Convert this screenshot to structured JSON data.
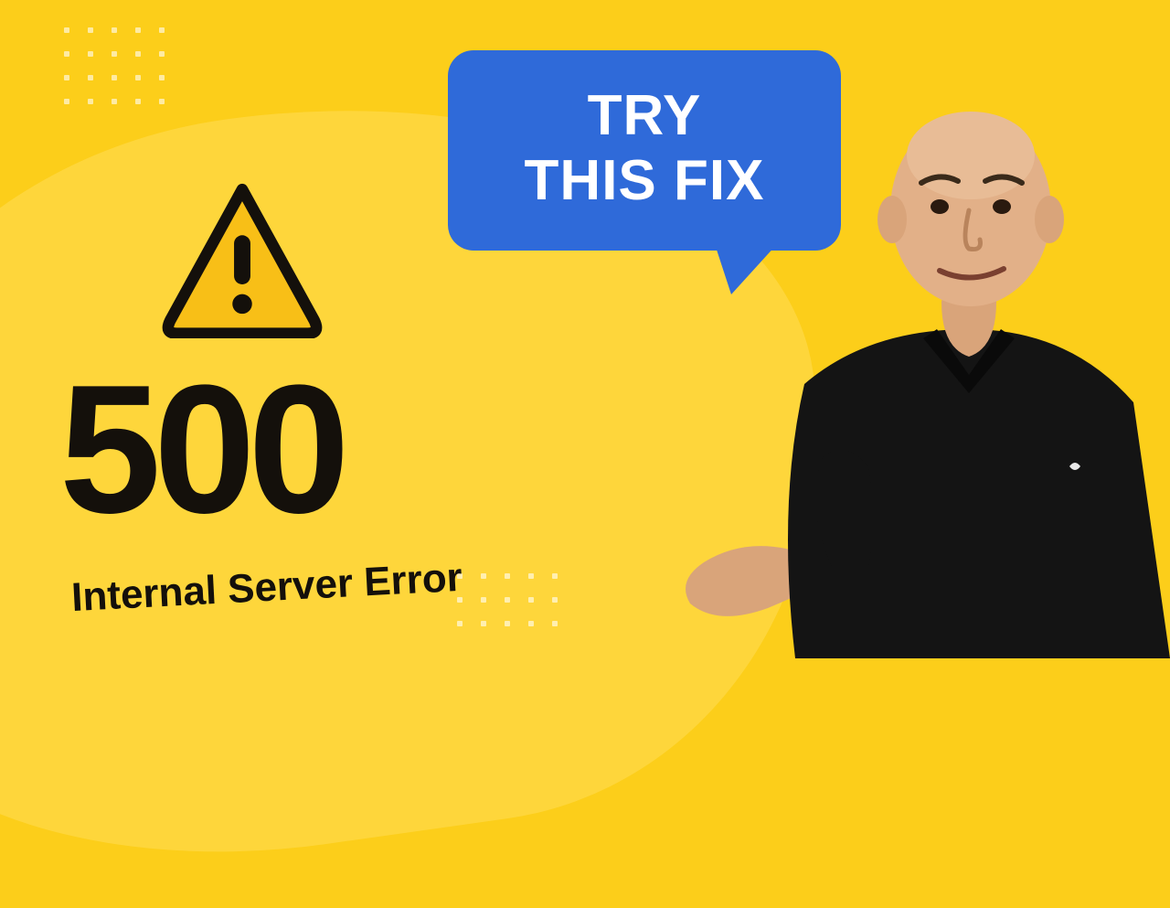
{
  "error": {
    "code": "500",
    "message": "Internal Server Error"
  },
  "bubble": {
    "line1": "TRY",
    "line2": "THIS FIX"
  },
  "colors": {
    "background": "#FCCE1A",
    "bubble": "#2F6AD9",
    "text": "#14100B"
  },
  "icons": {
    "warning": "warning-triangle"
  }
}
